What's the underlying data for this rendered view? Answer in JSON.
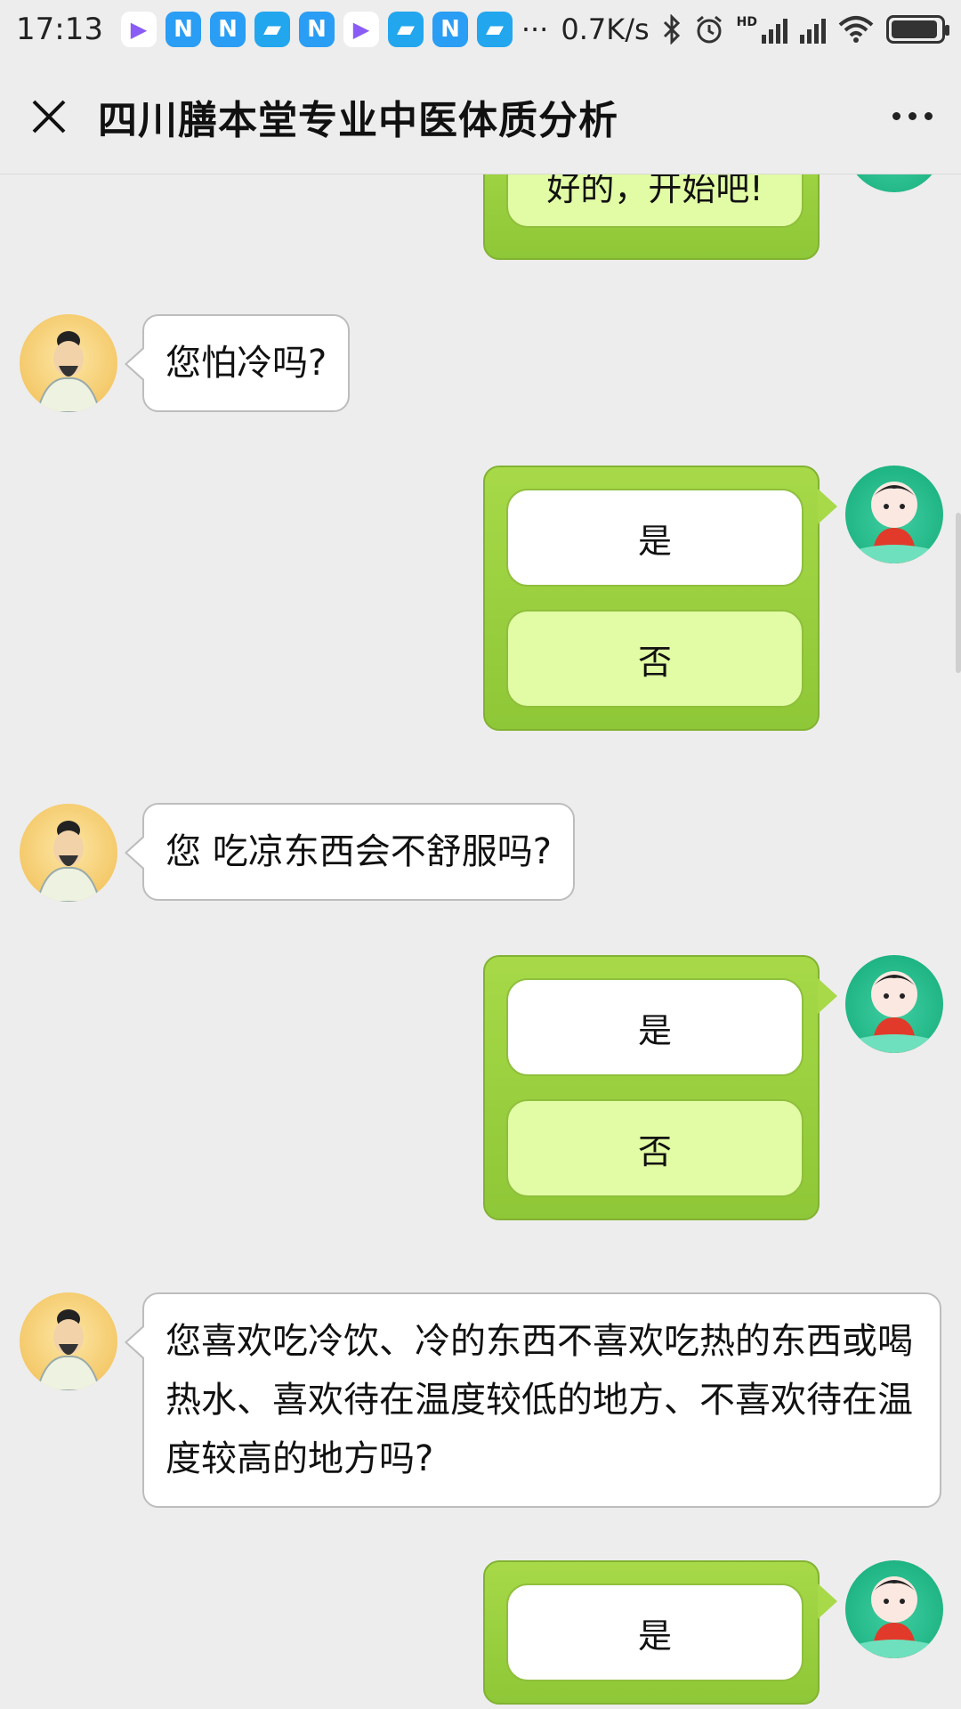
{
  "status_bar": {
    "time": "17:13",
    "network_speed": "0.7K/s",
    "hd_label": "HD",
    "icons": [
      "play-app-icon",
      "n-app-icon",
      "n-app-icon",
      "b-app-icon",
      "n-app-icon",
      "play-app-icon",
      "b-app-icon",
      "n-app-icon",
      "b-app-icon"
    ],
    "more_notifications": "···",
    "battery_level": 0.95
  },
  "header": {
    "title": "四川膳本堂专业中医体质分析"
  },
  "chat": {
    "previous_reply": "好的，开始吧!",
    "messages": [
      {
        "question": "您怕冷吗?",
        "options": [
          "是",
          "否"
        ]
      },
      {
        "question": "您 吃凉东西会不舒服吗?",
        "options": [
          "是",
          "否"
        ]
      },
      {
        "question": "您喜欢吃冷饮、冷的东西不喜欢吃热的东西或喝热水、喜欢待在温度较低的地方、不喜欢待在温度较高的地方吗?",
        "options": [
          "是"
        ]
      }
    ]
  },
  "colors": {
    "background": "#ededed",
    "option_group": "#a7d948",
    "option_lime": "#e1fca4",
    "avatar_green": "#20b584",
    "avatar_gold": "#f4c96a"
  }
}
